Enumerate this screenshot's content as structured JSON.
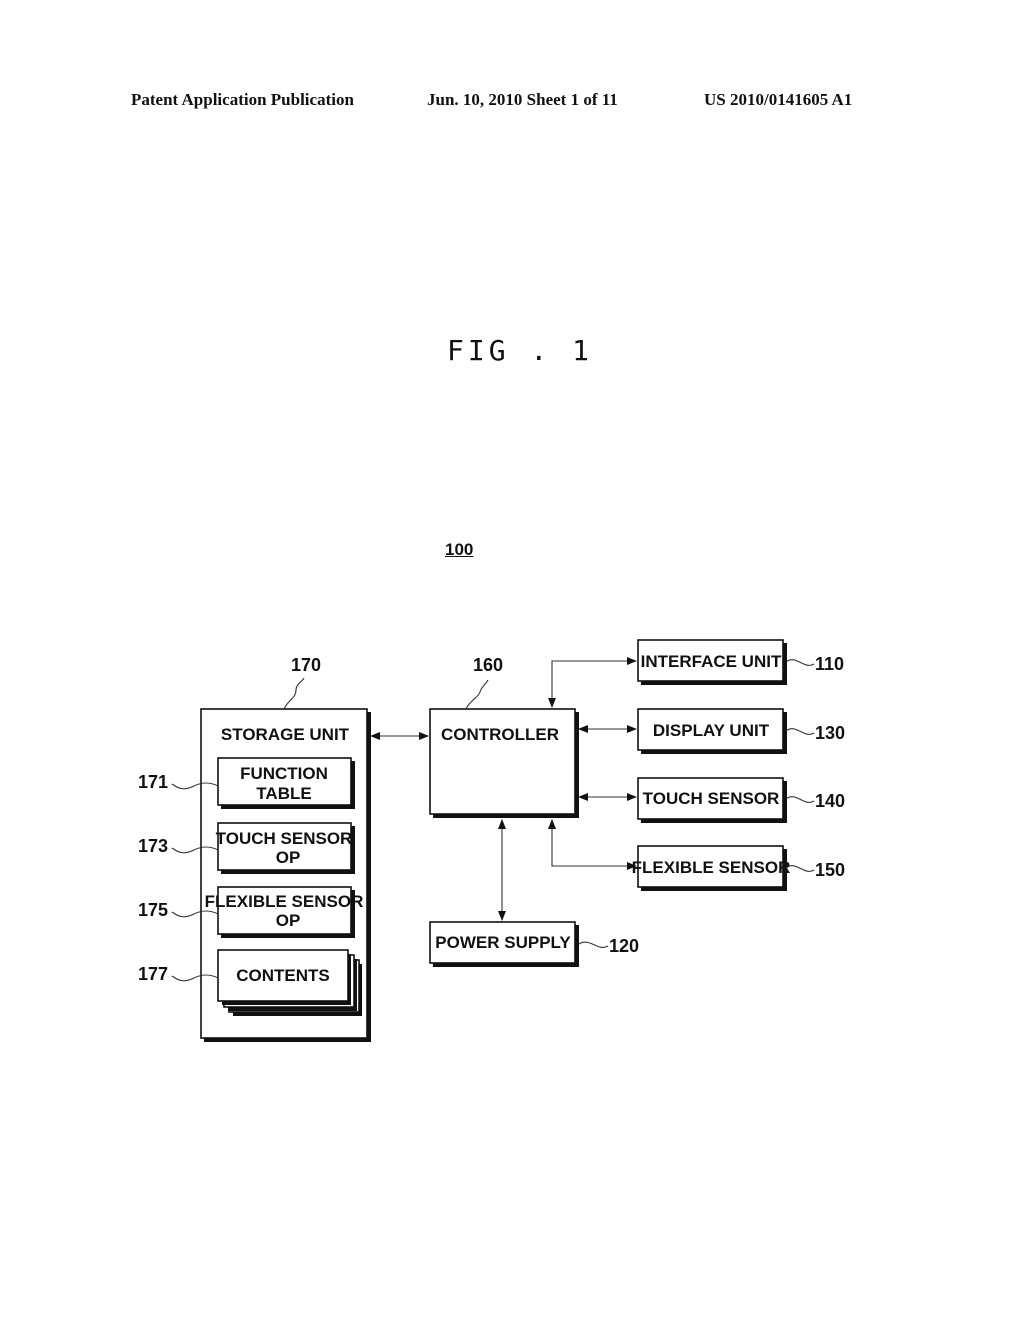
{
  "header": {
    "publication": "Patent Application Publication",
    "date_sheet": "Jun. 10, 2010  Sheet 1 of 11",
    "patent_number": "US 2010/0141605 A1"
  },
  "figure": {
    "title": "FIG . 1",
    "system_ref": "100"
  },
  "blocks": {
    "storage": {
      "label": "STORAGE UNIT",
      "ref": "170"
    },
    "function_table": {
      "line1": "FUNCTION",
      "line2": "TABLE",
      "ref": "171"
    },
    "touch_sensor_op": {
      "line1": "TOUCH SENSOR",
      "line2": "OP",
      "ref": "173"
    },
    "flexible_sensor_op": {
      "line1": "FLEXIBLE SENSOR",
      "line2": "OP",
      "ref": "175"
    },
    "contents": {
      "label": "CONTENTS",
      "ref": "177"
    },
    "controller": {
      "label": "CONTROLLER",
      "ref": "160"
    },
    "interface_unit": {
      "label": "INTERFACE UNIT",
      "ref": "110"
    },
    "display_unit": {
      "label": "DISPLAY UNIT",
      "ref": "130"
    },
    "touch_sensor": {
      "label": "TOUCH SENSOR",
      "ref": "140"
    },
    "flexible_sensor": {
      "label": "FLEXIBLE SENSOR",
      "ref": "150"
    },
    "power_supply": {
      "label": "POWER SUPPLY",
      "ref": "120"
    }
  },
  "connections": [
    {
      "from": "storage",
      "to": "controller",
      "type": "bidirectional"
    },
    {
      "from": "interface_unit",
      "to": "controller",
      "type": "bidirectional"
    },
    {
      "from": "controller",
      "to": "display_unit",
      "type": "bidirectional"
    },
    {
      "from": "controller",
      "to": "touch_sensor",
      "type": "bidirectional"
    },
    {
      "from": "flexible_sensor",
      "to": "controller",
      "type": "bidirectional"
    },
    {
      "from": "controller",
      "to": "power_supply",
      "type": "bidirectional"
    }
  ]
}
